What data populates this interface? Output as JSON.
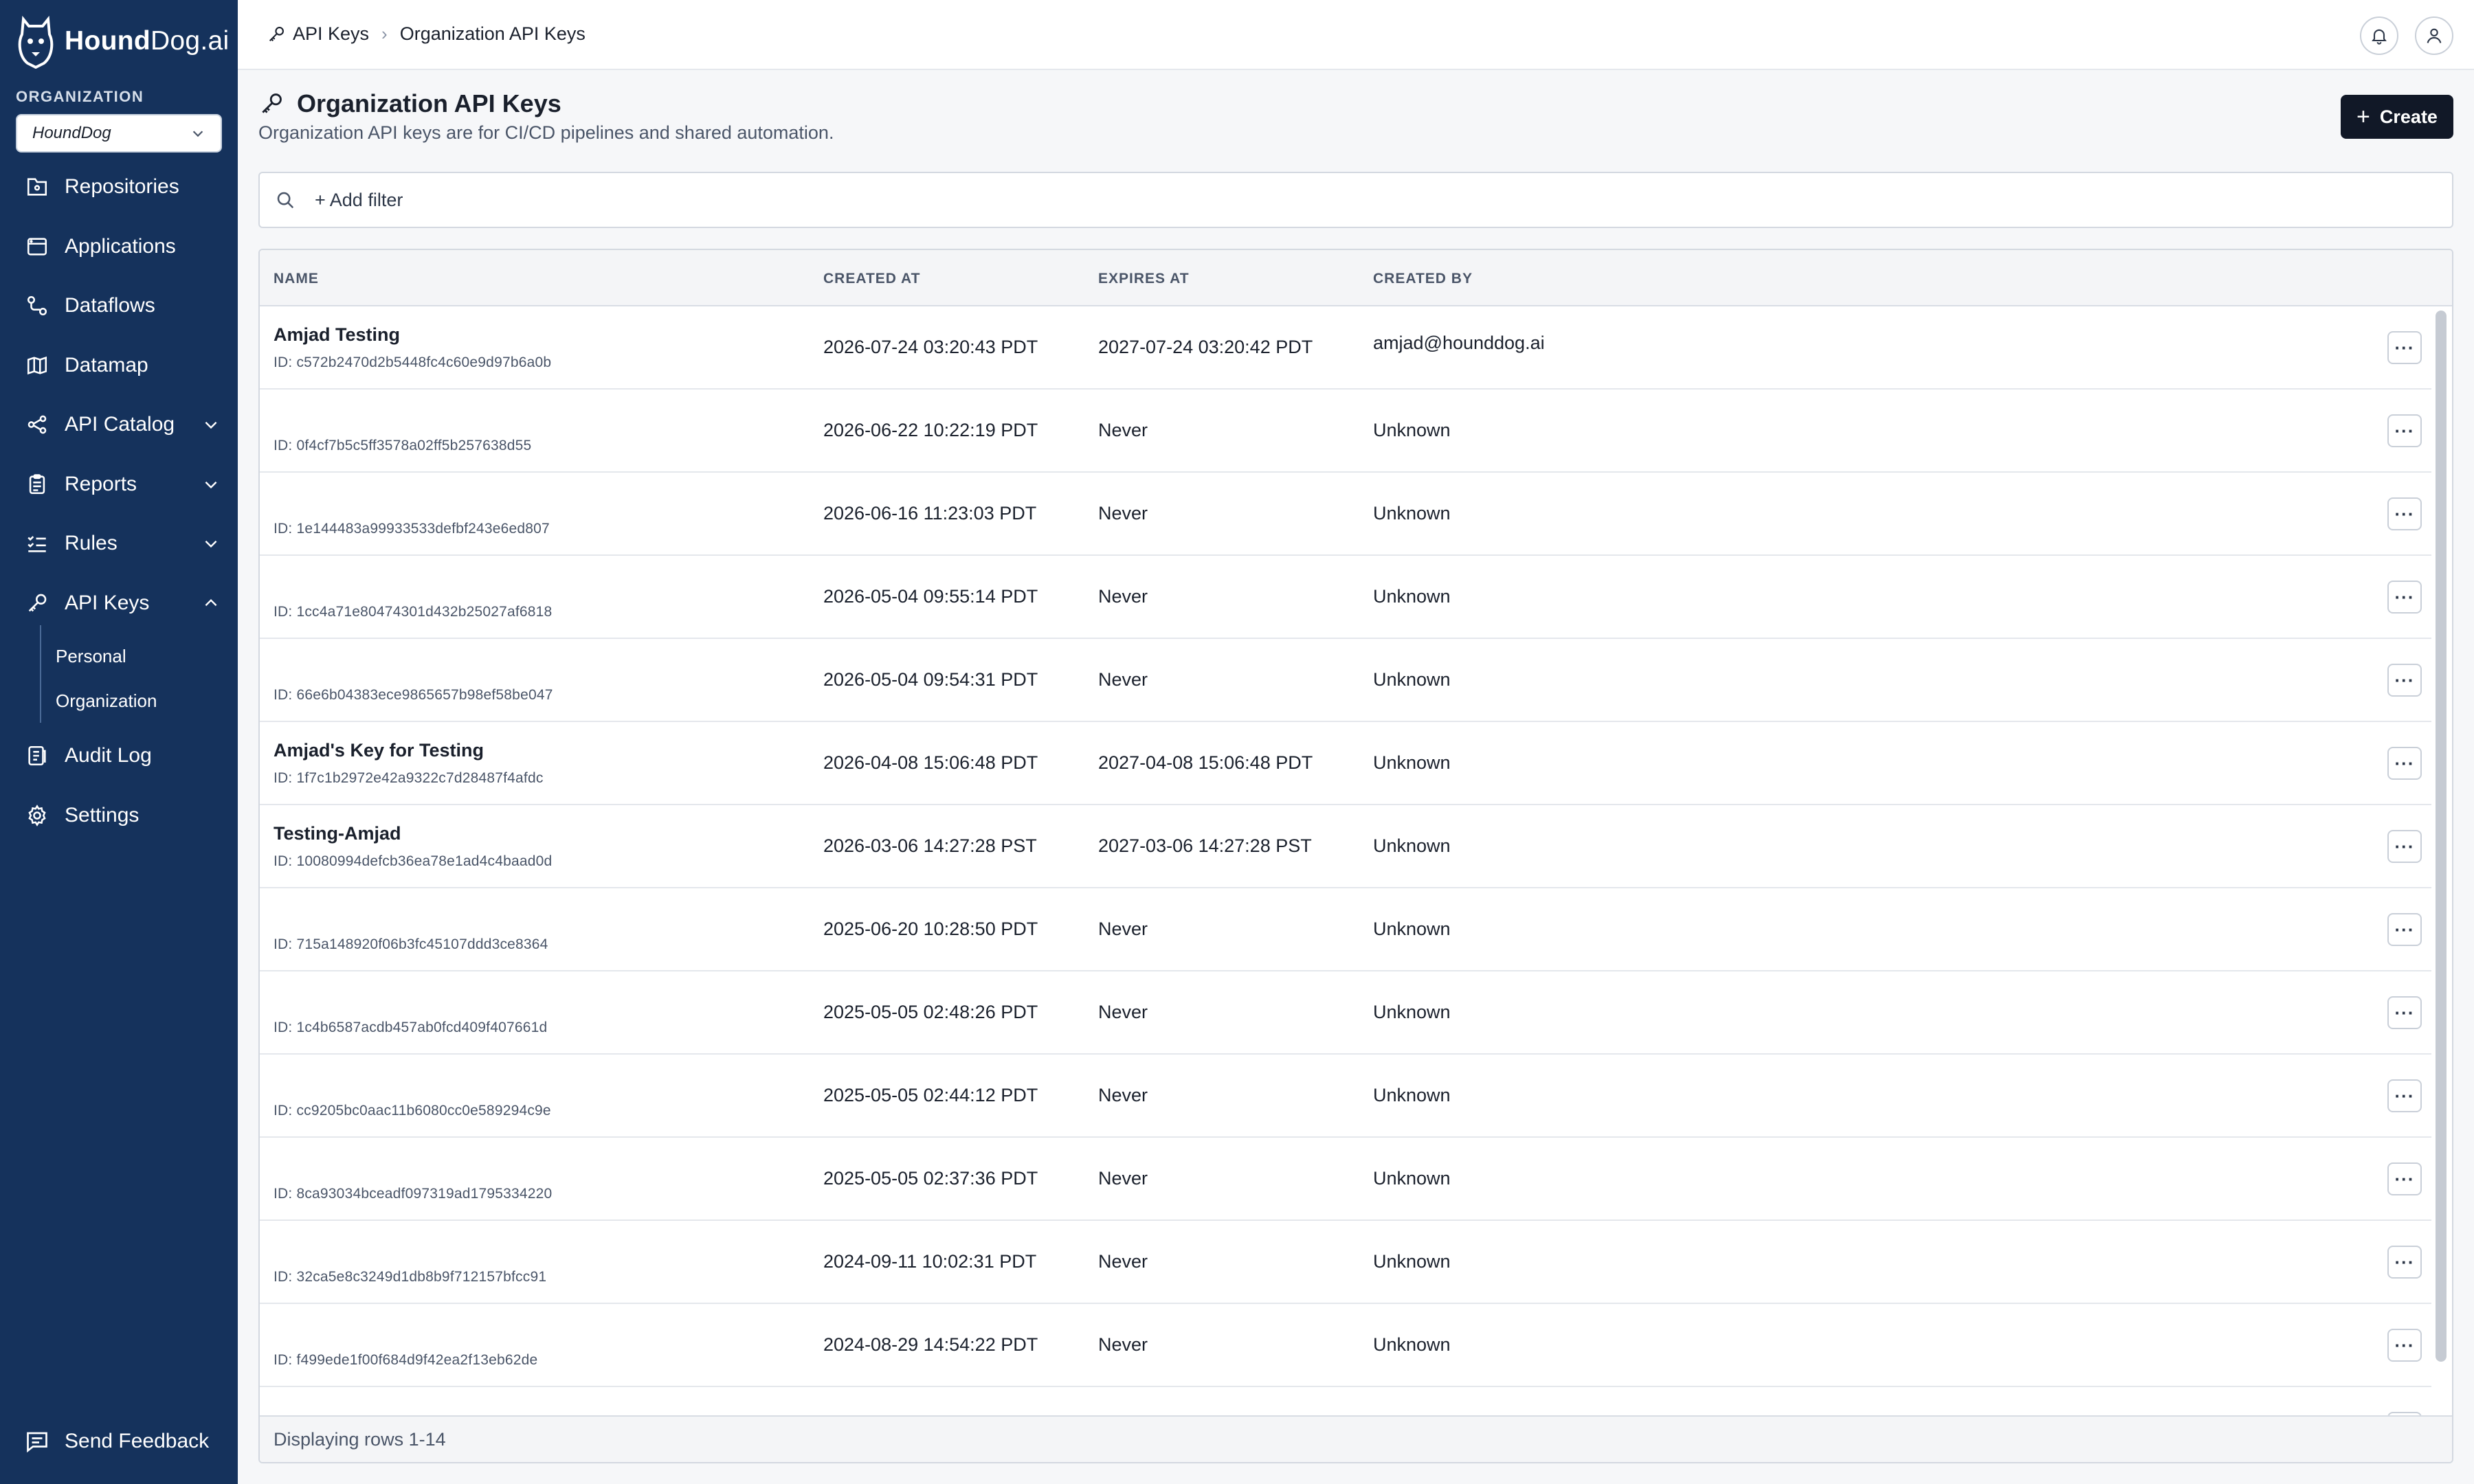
{
  "brand": {
    "name_bold": "Hound",
    "name_rest": "Dog.ai"
  },
  "organization": {
    "label": "ORGANIZATION",
    "selected": "HoundDog"
  },
  "sidebar": {
    "items": [
      {
        "label": "Repositories",
        "icon": "repository-icon"
      },
      {
        "label": "Applications",
        "icon": "application-icon"
      },
      {
        "label": "Dataflows",
        "icon": "dataflow-icon"
      },
      {
        "label": "Datamap",
        "icon": "map-icon"
      },
      {
        "label": "API Catalog",
        "icon": "api-catalog-icon",
        "expand": "chevron-down"
      },
      {
        "label": "Reports",
        "icon": "clipboard-icon",
        "expand": "chevron-down"
      },
      {
        "label": "Rules",
        "icon": "rules-icon",
        "expand": "chevron-down"
      },
      {
        "label": "API Keys",
        "icon": "key-icon",
        "expand": "chevron-up"
      },
      {
        "label": "Audit Log",
        "icon": "audit-log-icon"
      },
      {
        "label": "Settings",
        "icon": "gear-icon"
      }
    ],
    "api_keys_sub": [
      "Personal",
      "Organization"
    ],
    "feedback": "Send Feedback"
  },
  "breadcrumb": {
    "parent": "API Keys",
    "current": "Organization API Keys"
  },
  "header": {
    "title": "Organization API Keys",
    "description": "Organization API keys are for CI/CD pipelines and shared automation.",
    "create_label": "Create"
  },
  "filter": {
    "add_label": "+ Add filter"
  },
  "table": {
    "columns": [
      "NAME",
      "CREATED AT",
      "EXPIRES AT",
      "CREATED BY"
    ],
    "rows": [
      {
        "name": "Amjad Testing",
        "id": "ID: c572b2470d2b5448fc4c60e9d97b6a0b",
        "created": "2026-07-24 03:20:43 PDT",
        "expires": "2027-07-24 03:20:42 PDT",
        "by": "amjad@hounddog.ai"
      },
      {
        "name": "",
        "id": "ID: 0f4cf7b5c5ff3578a02ff5b257638d55",
        "created": "2026-06-22 10:22:19 PDT",
        "expires": "Never",
        "by": "Unknown"
      },
      {
        "name": "",
        "id": "ID: 1e144483a99933533defbf243e6ed807",
        "created": "2026-06-16 11:23:03 PDT",
        "expires": "Never",
        "by": "Unknown"
      },
      {
        "name": "",
        "id": "ID: 1cc4a71e80474301d432b25027af6818",
        "created": "2026-05-04 09:55:14 PDT",
        "expires": "Never",
        "by": "Unknown"
      },
      {
        "name": "",
        "id": "ID: 66e6b04383ece9865657b98ef58be047",
        "created": "2026-05-04 09:54:31 PDT",
        "expires": "Never",
        "by": "Unknown"
      },
      {
        "name": "Amjad's Key for Testing",
        "id": "ID: 1f7c1b2972e42a9322c7d28487f4afdc",
        "created": "2026-04-08 15:06:48 PDT",
        "expires": "2027-04-08 15:06:48 PDT",
        "by": "Unknown"
      },
      {
        "name": "Testing-Amjad",
        "id": "ID: 10080994defcb36ea78e1ad4c4baad0d",
        "created": "2026-03-06 14:27:28 PST",
        "expires": "2027-03-06 14:27:28 PST",
        "by": "Unknown"
      },
      {
        "name": "",
        "id": "ID: 715a148920f06b3fc45107ddd3ce8364",
        "created": "2025-06-20 10:28:50 PDT",
        "expires": "Never",
        "by": "Unknown"
      },
      {
        "name": "",
        "id": "ID: 1c4b6587acdb457ab0fcd409f407661d",
        "created": "2025-05-05 02:48:26 PDT",
        "expires": "Never",
        "by": "Unknown"
      },
      {
        "name": "",
        "id": "ID: cc9205bc0aac11b6080cc0e589294c9e",
        "created": "2025-05-05 02:44:12 PDT",
        "expires": "Never",
        "by": "Unknown"
      },
      {
        "name": "",
        "id": "ID: 8ca93034bceadf097319ad1795334220",
        "created": "2025-05-05 02:37:36 PDT",
        "expires": "Never",
        "by": "Unknown"
      },
      {
        "name": "",
        "id": "ID: 32ca5e8c3249d1db8b9f712157bfcc91",
        "created": "2024-09-11 10:02:31 PDT",
        "expires": "Never",
        "by": "Unknown"
      },
      {
        "name": "",
        "id": "ID: f499ede1f00f684d9f42ea2f13eb62de",
        "created": "2024-08-29 14:54:22 PDT",
        "expires": "Never",
        "by": "Unknown"
      }
    ],
    "footer": "Displaying rows 1-14"
  }
}
